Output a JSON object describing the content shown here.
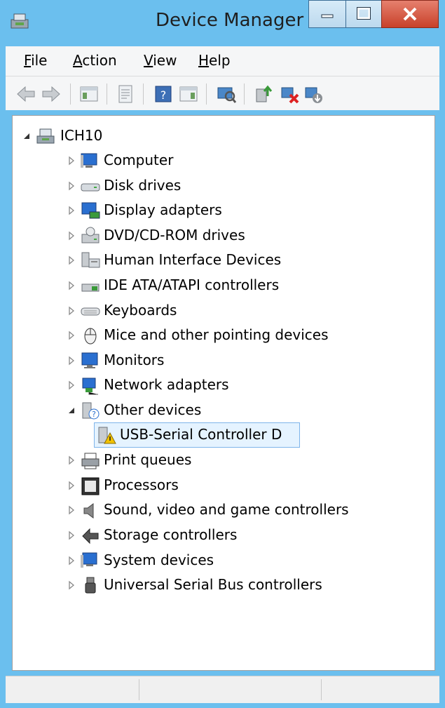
{
  "window": {
    "title": "Device Manager"
  },
  "menu": [
    "File",
    "Action",
    "View",
    "Help"
  ],
  "toolbar": [
    "back",
    "forward",
    "show-hide-console-tree",
    "properties",
    "help",
    "show-action-pane",
    "scan-hardware",
    "update-driver",
    "uninstall-device",
    "disable-device"
  ],
  "tree": {
    "root": "ICH10",
    "items": [
      {
        "label": "Computer",
        "icon": "computer-icon",
        "expanded": false
      },
      {
        "label": "Disk drives",
        "icon": "disk-drive-icon",
        "expanded": false
      },
      {
        "label": "Display adapters",
        "icon": "display-adapter-icon",
        "expanded": false
      },
      {
        "label": "DVD/CD-ROM drives",
        "icon": "dvd-drive-icon",
        "expanded": false
      },
      {
        "label": "Human Interface Devices",
        "icon": "hid-icon",
        "expanded": false
      },
      {
        "label": "IDE ATA/ATAPI controllers",
        "icon": "ide-controller-icon",
        "expanded": false
      },
      {
        "label": "Keyboards",
        "icon": "keyboard-icon",
        "expanded": false
      },
      {
        "label": "Mice and other pointing devices",
        "icon": "mouse-icon",
        "expanded": false
      },
      {
        "label": "Monitors",
        "icon": "monitor-icon",
        "expanded": false
      },
      {
        "label": "Network adapters",
        "icon": "network-adapter-icon",
        "expanded": false
      },
      {
        "label": "Other devices",
        "icon": "unknown-device-icon",
        "expanded": true,
        "children": [
          {
            "label": "USB-Serial Controller D",
            "icon": "warning-device-icon",
            "selected": true
          }
        ]
      },
      {
        "label": "Print queues",
        "icon": "printer-icon",
        "expanded": false
      },
      {
        "label": "Processors",
        "icon": "processor-icon",
        "expanded": false
      },
      {
        "label": "Sound, video and game controllers",
        "icon": "speaker-icon",
        "expanded": false
      },
      {
        "label": "Storage controllers",
        "icon": "storage-controller-icon",
        "expanded": false
      },
      {
        "label": "System devices",
        "icon": "system-device-icon",
        "expanded": false
      },
      {
        "label": "Universal Serial Bus controllers",
        "icon": "usb-icon",
        "expanded": false
      }
    ]
  },
  "colors": {
    "frame": "#6bbfee",
    "close": "#c8412a",
    "selection": "#e5f3ff",
    "selection_border": "#7eb4ea"
  }
}
